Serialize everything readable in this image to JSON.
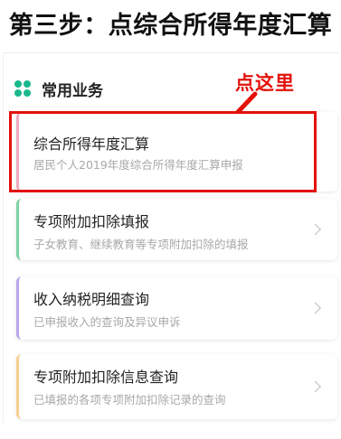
{
  "step_title": "第三步：点综合所得年度汇算",
  "section": {
    "label": "常用业务",
    "icon": "clover-icon"
  },
  "annotation": {
    "text": "点这里",
    "color": "#e3120b"
  },
  "cards": [
    {
      "title": "综合所得年度汇算",
      "desc": "居民个人2019年度综合所得年度汇算申报",
      "accent": "#f0aabe"
    },
    {
      "title": "专项附加扣除填报",
      "desc": "子女教育、继续教育等专项附加扣除的填报",
      "accent": "#7ed1a5"
    },
    {
      "title": "收入纳税明细查询",
      "desc": "已申报收入的查询及异议申诉",
      "accent": "#b8a8e8"
    },
    {
      "title": "专项附加扣除信息查询",
      "desc": "已填报的各项专项附加扣除记录的查询",
      "accent": "#f6cf92"
    }
  ],
  "colors": {
    "brand_green": "#19b88c",
    "highlight_red": "#e3120b"
  }
}
